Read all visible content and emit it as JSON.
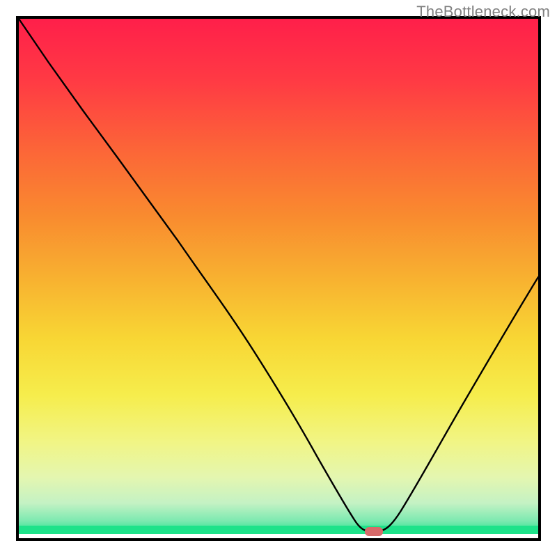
{
  "attribution": "TheBottleneck.com",
  "chart_data": {
    "type": "line",
    "title": "",
    "xlabel": "",
    "ylabel": "",
    "xlim": [
      0,
      100
    ],
    "ylim": [
      0,
      100
    ],
    "x": [
      0,
      5,
      10,
      15,
      20,
      25,
      30,
      35,
      40,
      45,
      50,
      55,
      60,
      62,
      64,
      66,
      68,
      70,
      75,
      80,
      85,
      90,
      95,
      100
    ],
    "values": [
      100,
      93,
      86,
      79,
      72,
      64,
      54,
      45,
      36,
      26,
      18,
      11,
      5,
      2,
      0,
      0,
      0,
      2,
      8,
      16,
      25,
      34,
      44,
      54
    ],
    "minimum_x": 65,
    "marker": {
      "x": 65,
      "y": 0,
      "color": "#d76a6a"
    },
    "background_gradient": [
      {
        "stop": 0.0,
        "color": "#ff1744"
      },
      {
        "stop": 0.2,
        "color": "#ff4b3e"
      },
      {
        "stop": 0.4,
        "color": "#f98f2e"
      },
      {
        "stop": 0.55,
        "color": "#f8c230"
      },
      {
        "stop": 0.7,
        "color": "#f8e93a"
      },
      {
        "stop": 0.82,
        "color": "#f2f66a"
      },
      {
        "stop": 0.9,
        "color": "#e6f7a8"
      },
      {
        "stop": 0.96,
        "color": "#b6f0c0"
      },
      {
        "stop": 1.0,
        "color": "#1ee28a"
      }
    ]
  }
}
